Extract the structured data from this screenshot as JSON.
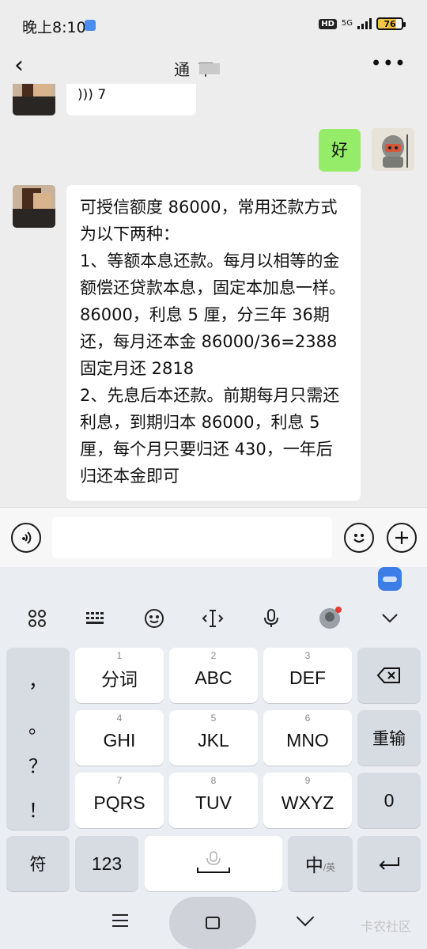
{
  "status_bar": {
    "time": "晚上8:10",
    "hd": "HD",
    "network": "5G",
    "battery": "76"
  },
  "header": {
    "title": "通  下",
    "back_icon": "chevron-left-icon",
    "more_icon": "more-dots-icon"
  },
  "messages": [
    {
      "side": "left",
      "type": "voice",
      "text": "7"
    },
    {
      "side": "right",
      "type": "text",
      "text": "好"
    },
    {
      "side": "left",
      "type": "text",
      "text": "可授信额度 86000，常用还款方式为以下两种：\n1、等额本息还款。每月以相等的金额偿还贷款本息，固定本加息一样。86000，利息 5 厘，分三年 36期还，每月还本金 86000/36=2388 固定月还 2818\n2、先息后本还款。前期每月只需还利息，到期归本 86000，利息 5 厘，每个月只要归还 430，一年后归还本金即可"
    }
  ],
  "input_bar": {
    "voice_icon": "voice-icon",
    "emoji_icon": "emoji-icon",
    "plus_icon": "plus-icon",
    "value": ""
  },
  "keyboard": {
    "toolbar": [
      "grid-icon",
      "keyboard-icon",
      "smile-icon",
      "cursor-icon",
      "mic-icon",
      "avatar-icon",
      "chevron-down-icon"
    ],
    "side_punct": [
      "，",
      "。",
      "？",
      "！"
    ],
    "keys": [
      {
        "num": "1",
        "label": "分词"
      },
      {
        "num": "2",
        "label": "ABC"
      },
      {
        "num": "3",
        "label": "DEF"
      },
      {
        "num": "4",
        "label": "GHI"
      },
      {
        "num": "5",
        "label": "JKL"
      },
      {
        "num": "6",
        "label": "MNO"
      },
      {
        "num": "7",
        "label": "PQRS"
      },
      {
        "num": "8",
        "label": "TUV"
      },
      {
        "num": "9",
        "label": "WXYZ"
      }
    ],
    "reenter": "重输",
    "zero": "0",
    "symbols": "符",
    "num123": "123",
    "lang_main": "中",
    "lang_sub": "/英"
  },
  "watermark": "卡农社区"
}
